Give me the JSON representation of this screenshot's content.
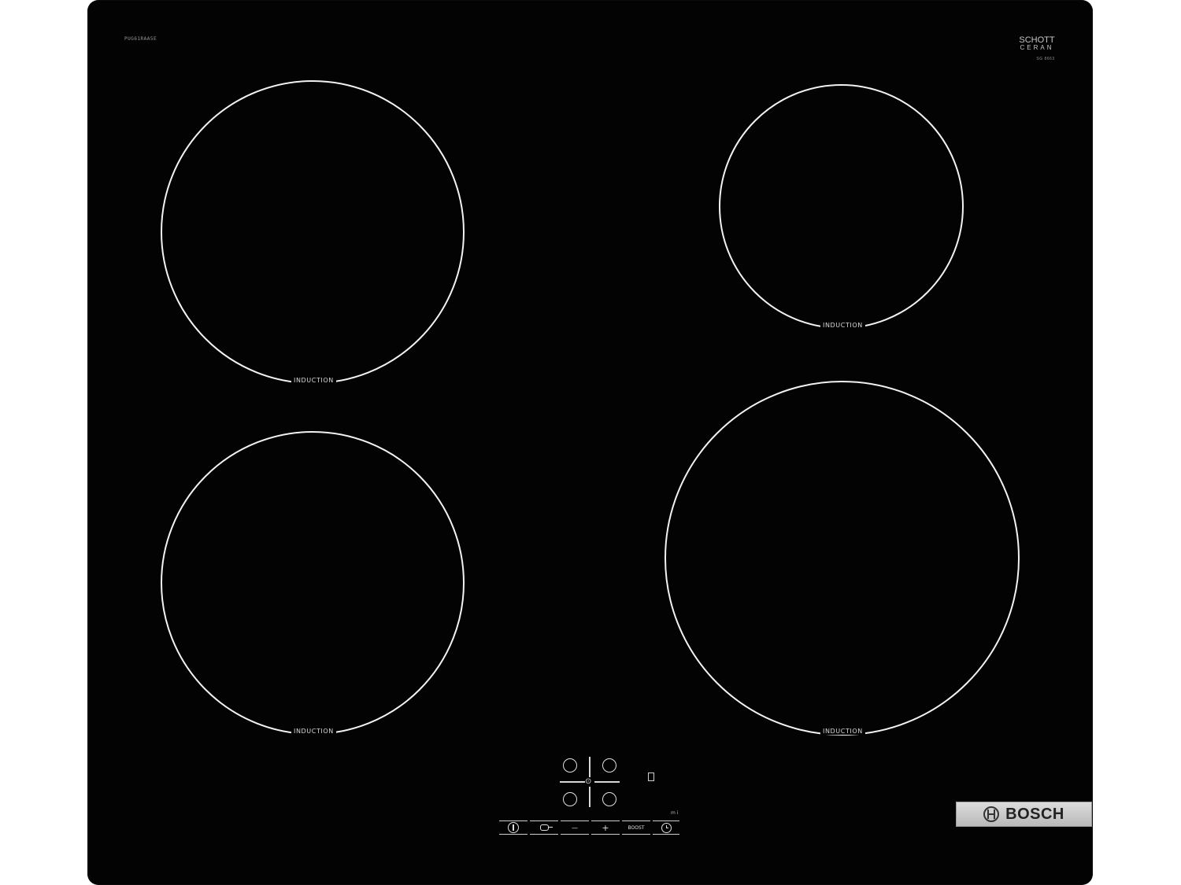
{
  "hob": {
    "model_code": "PUG61RAA5E",
    "glass_brand_line1": "SCHOTT",
    "glass_brand_line2": "CERAN",
    "glass_brand_line3": "SG 8663",
    "brand": "BOSCH",
    "surface_color": "#030303",
    "zone_ring_color": "#f2f2f2"
  },
  "zones": [
    {
      "id": "front-left-top",
      "label": "INDUCTION"
    },
    {
      "id": "rear-right",
      "label": "INDUCTION"
    },
    {
      "id": "front-left-bottom",
      "label": "INDUCTION"
    },
    {
      "id": "front-right",
      "label": "INDUCTION"
    }
  ],
  "controls": {
    "power_icon": "power-icon",
    "lock_icon": "child-lock-icon",
    "minus_symbol": "—",
    "plus_symbol": "+",
    "boost_label": "BOOST",
    "timer_icon": "clock-icon",
    "indicator_small": "m i",
    "zone_indicator": "⊙"
  }
}
